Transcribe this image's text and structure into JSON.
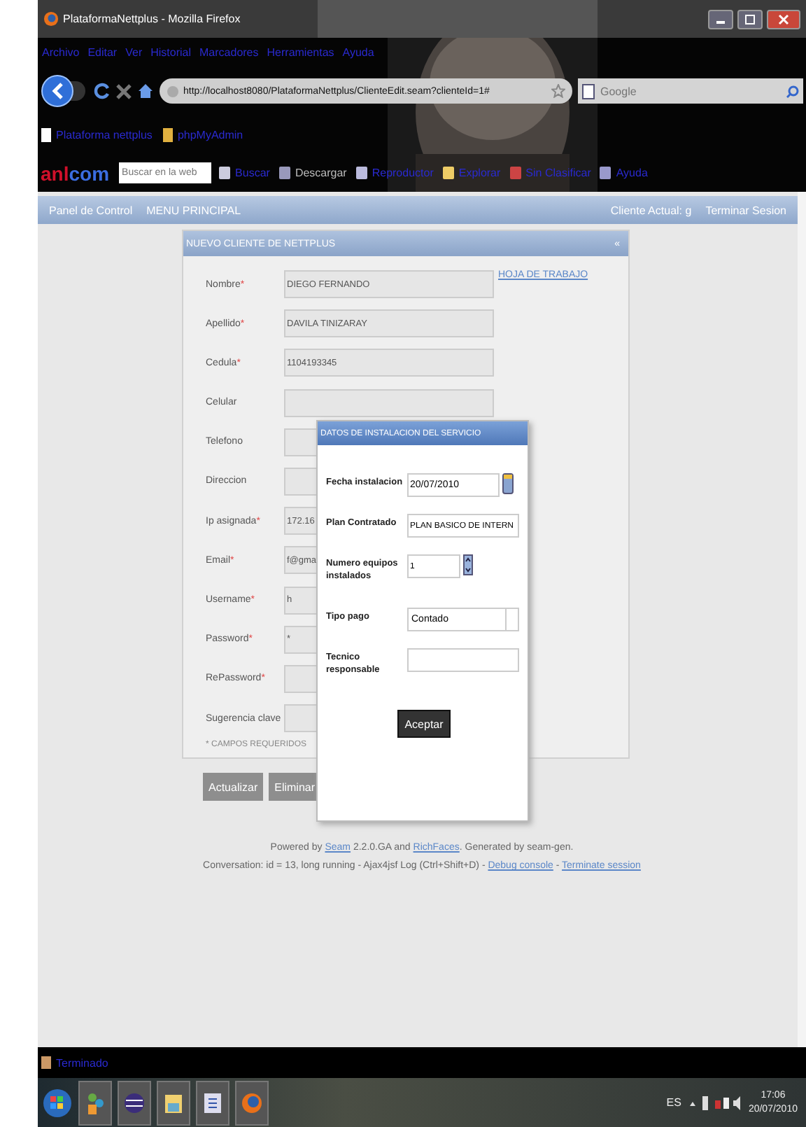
{
  "window": {
    "title": "PlataformaNettplus - Mozilla Firefox"
  },
  "menu": [
    "Archivo",
    "Editar",
    "Ver",
    "Historial",
    "Marcadores",
    "Herramientas",
    "Ayuda"
  ],
  "address_bar": {
    "url": "http://localhost8080/PlataformaNettplus/ClienteEdit.seam?clienteId=1#"
  },
  "search": {
    "placeholder": "Google"
  },
  "bookmarks": [
    "Plataforma nettplus",
    "phpMyAdmin"
  ],
  "toolbar": {
    "logo_part_1": "anl",
    "logo_part_2": "com",
    "search_placeholder": "Buscar en la web",
    "items": [
      "Buscar",
      "Descargar",
      "Reproductor",
      "Explorar",
      "Sin Clasificar",
      "Ayuda"
    ]
  },
  "app_nav": {
    "left": [
      "Panel de Control",
      "MENU PRINCIPAL"
    ],
    "right": [
      "Cliente Actual: g",
      "Terminar Sesion"
    ]
  },
  "panel": {
    "title": "NUEVO CLIENTE DE NETTPLUS",
    "collapse": "«",
    "link": "HOJA DE TRABAJO",
    "fields": [
      {
        "label": "Nombre",
        "mark": "*",
        "value": "DIEGO FERNANDO"
      },
      {
        "label": "Apellido",
        "mark": "*",
        "value": "DAVILA TINIZARAY"
      },
      {
        "label": "Cedula",
        "mark": "*",
        "value": "1104193345"
      },
      {
        "label": "Celular"
      },
      {
        "label": "Telefono"
      },
      {
        "label": "Direccion"
      },
      {
        "label": "Ip asignada",
        "mark": "*",
        "value": "172.16"
      },
      {
        "label": "Email",
        "mark": "*",
        "value": "f@gma"
      },
      {
        "label": "Username",
        "mark": "*",
        "value": "h"
      },
      {
        "label": "Password",
        "mark": "*",
        "value": "*"
      },
      {
        "label": "RePassword",
        "mark": "*"
      },
      {
        "label": "Sugerencia clave"
      }
    ],
    "note": "* CAMPOS REQUERIDOS"
  },
  "buttons": [
    "Actualizar",
    "Eliminar"
  ],
  "dialog": {
    "title": "DATOS DE INSTALACION DEL SERVICIO",
    "rows": [
      {
        "kind": "date",
        "label": "Fecha instalacion",
        "value": "20/07/2010"
      },
      {
        "kind": "text",
        "label": "Plan Contratado",
        "value": "PLAN BASICO DE INTERN"
      },
      {
        "kind": "spinner",
        "label": "Numero equipos instalados",
        "value": "1"
      },
      {
        "kind": "select",
        "label": "Tipo pago",
        "value": "Contado"
      },
      {
        "kind": "text",
        "label": "Tecnico responsable"
      }
    ],
    "button": "Aceptar"
  },
  "footer": [
    [
      {
        "kind": "text",
        "text": "Powered by "
      },
      {
        "kind": "link",
        "text": "Seam"
      },
      {
        "kind": "text",
        "text": " 2.2.0.GA and "
      },
      {
        "kind": "link",
        "text": "RichFaces"
      },
      {
        "kind": "text",
        "text": ". Generated by seam-gen."
      }
    ],
    [
      {
        "kind": "text",
        "text": "Conversation: id = 13, long running - Ajax4jsf Log (Ctrl+Shift+D) - "
      },
      {
        "kind": "link",
        "text": "Debug console"
      },
      {
        "kind": "text",
        "text": " - "
      },
      {
        "kind": "link",
        "text": "Terminate session"
      }
    ]
  ],
  "status_bar": "Terminado",
  "taskbar": {
    "language": "ES",
    "time": "17:06",
    "date": "20/07/2010"
  }
}
